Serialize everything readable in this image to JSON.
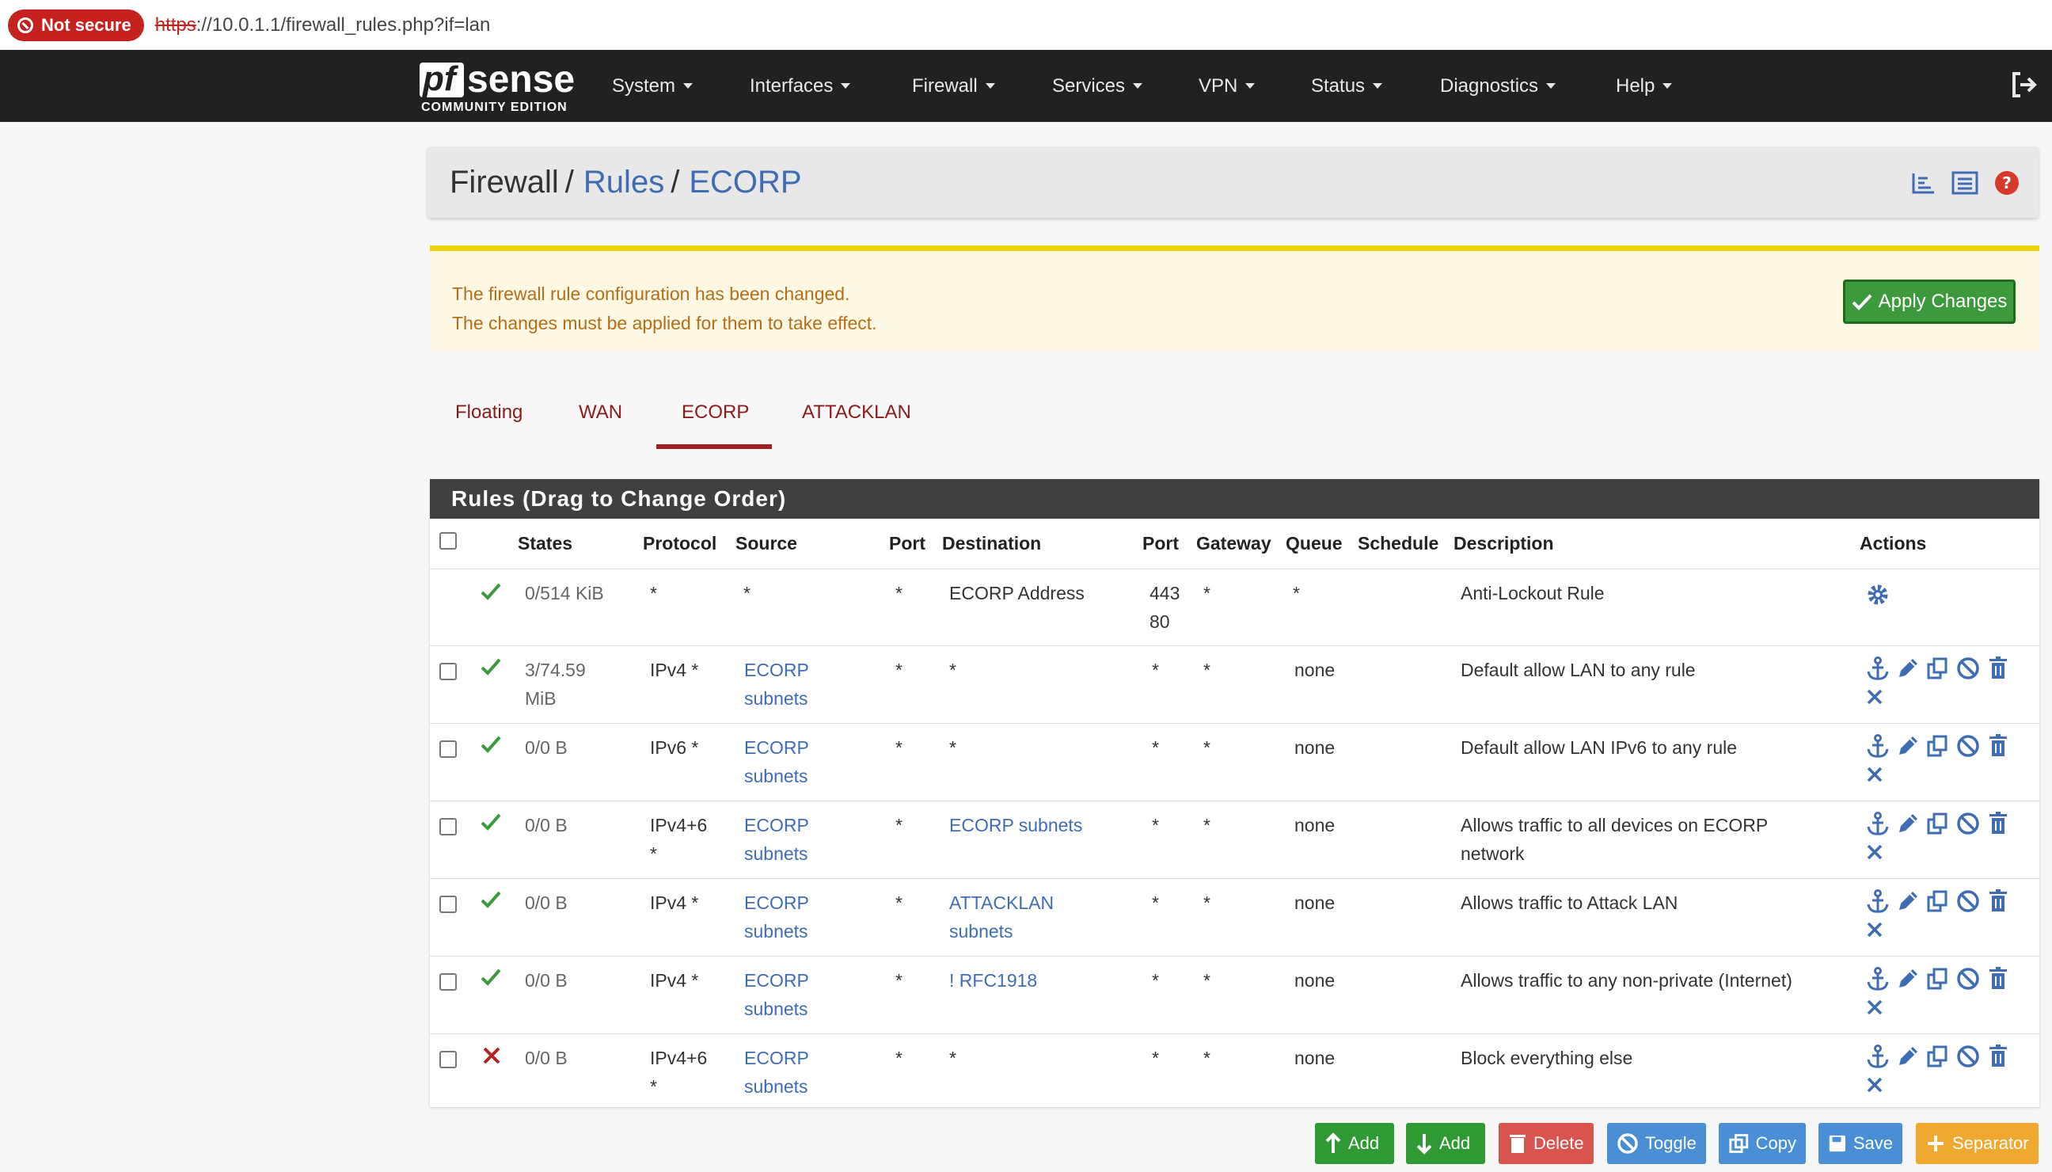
{
  "browser": {
    "security_label": "Not secure",
    "url_scheme": "https",
    "url_rest": "://10.0.1.1/firewall_rules.php?if=lan"
  },
  "navbar": {
    "logo_top": "sense",
    "logo_pf": "pf",
    "logo_sub": "COMMUNITY EDITION",
    "menu": [
      "System",
      "Interfaces",
      "Firewall",
      "Services",
      "VPN",
      "Status",
      "Diagnostics",
      "Help"
    ]
  },
  "breadcrumb": {
    "part1": "Firewall",
    "part2": "Rules",
    "part3": "ECORP"
  },
  "alert": {
    "line1": "The firewall rule configuration has been changed.",
    "line2": "The changes must be applied for them to take effect.",
    "apply_label": "Apply Changes"
  },
  "tabs": [
    "Floating",
    "WAN",
    "ECORP",
    "ATTACKLAN"
  ],
  "active_tab": "ECORP",
  "rules": {
    "title": "Rules (Drag to Change Order)",
    "columns": {
      "states": "States",
      "protocol": "Protocol",
      "source": "Source",
      "port": "Port",
      "destination": "Destination",
      "dport": "Port",
      "gateway": "Gateway",
      "queue": "Queue",
      "schedule": "Schedule",
      "description": "Description",
      "actions": "Actions"
    },
    "rows": [
      {
        "status": "pass",
        "states1": "0/514 KiB",
        "states2": "",
        "proto1": "*",
        "proto2": "",
        "src1": "*",
        "src2": "",
        "sport": "*",
        "dst1": "ECORP Address",
        "dst2": "",
        "dport1": "443",
        "dport2": "80",
        "gw": "*",
        "queue": "*",
        "desc1": "Anti-Lockout Rule",
        "desc2": ""
      },
      {
        "status": "pass",
        "states1": "3/74.59",
        "states2": "MiB",
        "proto1": "IPv4 *",
        "proto2": "",
        "src1": "ECORP",
        "src2": "subnets",
        "sport": "*",
        "dst1": "*",
        "dst2": "",
        "dport1": "*",
        "dport2": "",
        "gw": "*",
        "queue": "none",
        "desc1": "Default allow LAN to any rule",
        "desc2": ""
      },
      {
        "status": "pass",
        "states1": "0/0 B",
        "states2": "",
        "proto1": "IPv6 *",
        "proto2": "",
        "src1": "ECORP",
        "src2": "subnets",
        "sport": "*",
        "dst1": "*",
        "dst2": "",
        "dport1": "*",
        "dport2": "",
        "gw": "*",
        "queue": "none",
        "desc1": "Default allow LAN IPv6 to any rule",
        "desc2": ""
      },
      {
        "status": "pass",
        "states1": "0/0 B",
        "states2": "",
        "proto1": "IPv4+6",
        "proto2": "*",
        "src1": "ECORP",
        "src2": "subnets",
        "sport": "*",
        "dst1": "ECORP subnets",
        "dst2": "",
        "dport1": "*",
        "dport2": "",
        "gw": "*",
        "queue": "none",
        "desc1": "Allows traffic to all devices on ECORP",
        "desc2": "network"
      },
      {
        "status": "pass",
        "states1": "0/0 B",
        "states2": "",
        "proto1": "IPv4 *",
        "proto2": "",
        "src1": "ECORP",
        "src2": "subnets",
        "sport": "*",
        "dst1": "ATTACKLAN",
        "dst2": "subnets",
        "dport1": "*",
        "dport2": "",
        "gw": "*",
        "queue": "none",
        "desc1": "Allows traffic to Attack LAN",
        "desc2": ""
      },
      {
        "status": "pass",
        "states1": "0/0 B",
        "states2": "",
        "proto1": "IPv4 *",
        "proto2": "",
        "src1": "ECORP",
        "src2": "subnets",
        "sport": "*",
        "dst1": "! RFC1918",
        "dst2": "",
        "dport1": "*",
        "dport2": "",
        "gw": "*",
        "queue": "none",
        "desc1": "Allows traffic to any non-private (Internet)",
        "desc2": ""
      },
      {
        "status": "block",
        "states1": "0/0 B",
        "states2": "",
        "proto1": "IPv4+6",
        "proto2": "*",
        "src1": "ECORP",
        "src2": "subnets",
        "sport": "*",
        "dst1": "*",
        "dst2": "",
        "dport1": "*",
        "dport2": "",
        "gw": "*",
        "queue": "none",
        "desc1": "Block everything else",
        "desc2": ""
      }
    ]
  },
  "bottom_buttons": {
    "add_top": "Add",
    "add_bottom": "Add",
    "delete": "Delete",
    "toggle": "Toggle",
    "copy": "Copy",
    "save": "Save",
    "separator": "Separator"
  },
  "colors": {
    "navbar": "#212121",
    "link": "#3f6db3",
    "tab_active": "#a32020",
    "pass": "#3c9a3c",
    "block": "#b22222",
    "alert_bg": "#fcf8e3"
  }
}
